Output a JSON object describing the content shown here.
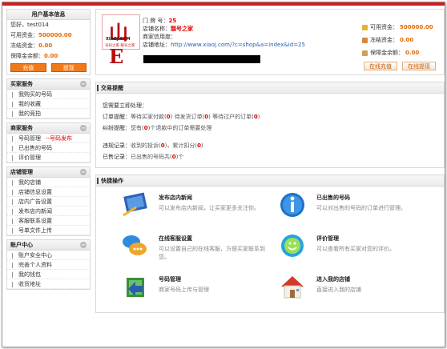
{
  "user": {
    "title": "用户基本信息",
    "greeting": "您好，test014",
    "available_label": "可用资金：",
    "available_value": "500000.00",
    "frozen_label": "冻结资金：",
    "frozen_value": "0.00",
    "deposit_label": "保障金余额：",
    "deposit_value": "0.00",
    "recharge_btn": "充值",
    "withdraw_btn": "提现"
  },
  "sidebar": {
    "sections": [
      {
        "title": "买家服务",
        "items": [
          "我购买的号码",
          "我的收藏",
          "我的竞拍"
        ]
      },
      {
        "title": "商家服务",
        "items": [
          "号码管理",
          "已出售的号码",
          "评价管理"
        ],
        "hot": "--号码发布"
      },
      {
        "title": "店铺管理",
        "items": [
          "我的店铺",
          "店铺信息设置",
          "店内广告设置",
          "发布店内新闻",
          "客服联系设置",
          "号单文件上传"
        ]
      },
      {
        "title": "账户中心",
        "items": [
          "账户安全中心",
          "完善个人资料",
          "我的钱包",
          "收货地址"
        ]
      }
    ],
    "toggle_glyph": "−"
  },
  "shop": {
    "logo_big": "山E",
    "logo_name": "XIAOJ.COM",
    "logo_sub": "号码之家  靓号之家",
    "number_label": "门 牌 号：",
    "number_value": "25",
    "name_label": "店铺名称：",
    "name_value": "靓号之家",
    "credit_label": "商家信用度：",
    "url_label": "店铺地址：",
    "url_value": "http://www.xiaoj.com/?c=shop&a=index&id=25"
  },
  "funds": {
    "available_label": "可用资金：",
    "available_value": "500000.00",
    "frozen_label": "冻结资金：",
    "frozen_value": "0.00",
    "deposit_label": "保障金余额：",
    "deposit_value": "0.00",
    "recharge_btn": "在线充值",
    "withdraw_btn": "在线提现"
  },
  "trade": {
    "title": "交易提醒",
    "pending": "您需要立即处理：",
    "orders_label": "订单提醒：",
    "orders_a": "等待买家付款(",
    "orders_a_n": "0",
    "orders_b": ")  待发货订单(",
    "orders_b_n": "0",
    "orders_c": ")  等待过户的订单(",
    "orders_c_n": "0",
    "orders_end": ")",
    "dispute_label": "纠纷提醒：",
    "dispute_a": "您有(",
    "dispute_n": "0",
    "dispute_b": ")个退款中的订单需要处理",
    "violation_label": "违规记录：",
    "violation_a": "收到的投诉(",
    "violation_n": "0",
    "violation_b": ")，累计扣分(",
    "violation_m": "0",
    "violation_c": ")",
    "sold_label": "已售记录：",
    "sold_a": "已出售的号码共(",
    "sold_n": "0",
    "sold_b": ")个"
  },
  "quick": {
    "title": "快捷操作",
    "items": [
      {
        "title": "发布店内新闻",
        "desc": "可以发布店内新闻，让买家更多关注你。"
      },
      {
        "title": "已出售的号码",
        "desc": "可以对出售的号码的订单进行管理。"
      },
      {
        "title": "在线客服设置",
        "desc": "可以设置自己的在线客服，方便买家联系到您。"
      },
      {
        "title": "评价管理",
        "desc": "可以查看所有买家对您的评价。"
      },
      {
        "title": "号码管理",
        "desc": "商家号码上传与管理"
      },
      {
        "title": "进入我的店铺",
        "desc": "直接进入我的店铺"
      }
    ]
  },
  "colors": {
    "accent_red": "#c81f1f",
    "value_orange": "#e66a00",
    "button_orange": "#f07a1a",
    "link_blue": "#2a5db0"
  }
}
